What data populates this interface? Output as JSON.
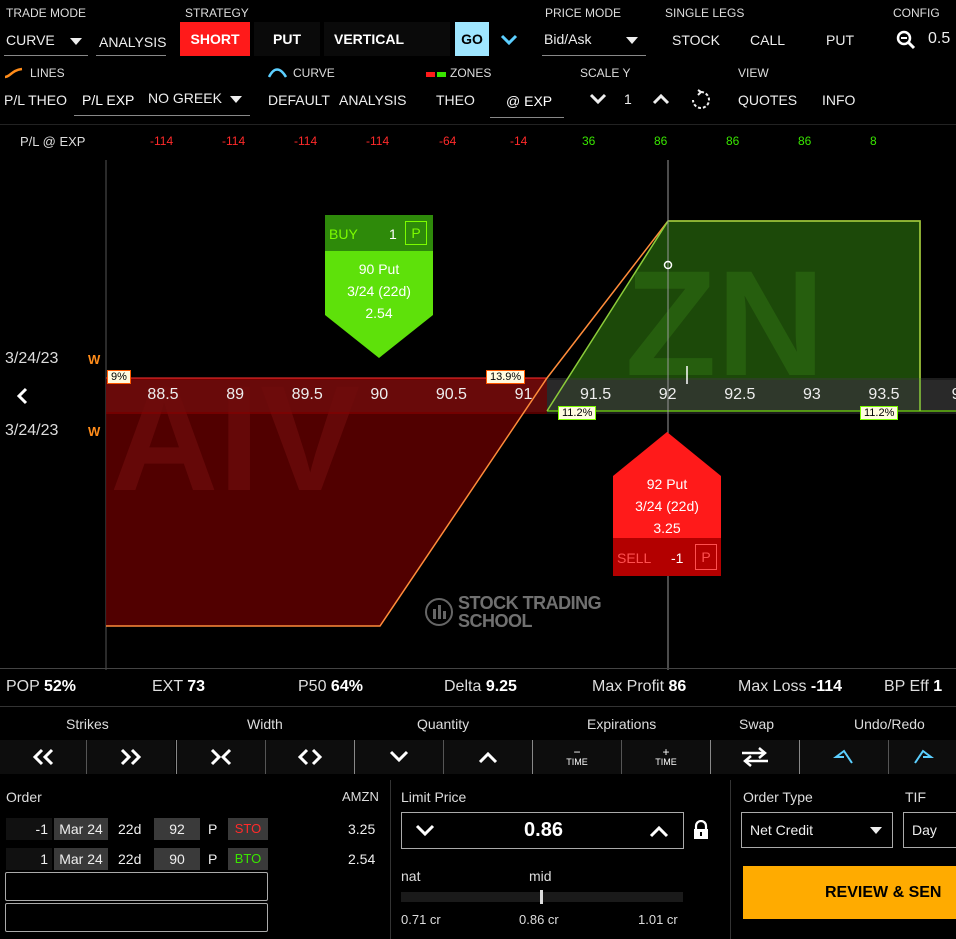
{
  "toolbar_row1": {
    "trade_mode_label": "TRADE MODE",
    "trade_mode_value": "CURVE",
    "analysis_label": "ANALYSIS",
    "strategy_label": "STRATEGY",
    "short_label": "SHORT",
    "put_label": "PUT",
    "vertical_label": "VERTICAL",
    "go_label": "GO",
    "price_mode_label": "PRICE MODE",
    "price_mode_value": "Bid/Ask",
    "single_legs_label": "SINGLE LEGS",
    "stock_label": "STOCK",
    "call_label": "CALL",
    "put_leg_label": "PUT",
    "config_label": "CONFIG",
    "zoom_value": "0.5"
  },
  "toolbar_row2": {
    "lines_label": "LINES",
    "pl_theo_label": "P/L THEO",
    "pl_exp_label": "P/L EXP",
    "greek_value": "NO GREEK",
    "curve_label": "CURVE",
    "default_label": "DEFAULT",
    "analysis_label": "ANALYSIS",
    "zones_label": "ZONES",
    "theo_label": "THEO",
    "at_exp_label": "@ EXP",
    "scale_y_label": "SCALE Y",
    "scale_y_value": "1",
    "view_label": "VIEW",
    "quotes_label": "QUOTES",
    "info_label": "INFO"
  },
  "pl_row": {
    "label": "P/L @ EXP",
    "values": [
      "-114",
      "-114",
      "-114",
      "-114",
      "-64",
      "-14",
      "36",
      "86",
      "86",
      "86",
      "8"
    ]
  },
  "chart": {
    "expiry_top": "3/24/23",
    "expiry_bottom": "3/24/23",
    "weekly_marker": "W",
    "strikes": [
      "88.5",
      "89",
      "89.5",
      "90",
      "90.5",
      "91",
      "91.5",
      "92",
      "92.5",
      "93",
      "93.5",
      "9"
    ],
    "iv_tags": {
      "left_partial": "9%",
      "red_tag": "13.9%",
      "green_left": "11.2%",
      "green_right": "11.2%"
    },
    "watermark": "STOCK TRADING SCHOOL",
    "buy_leg": {
      "action": "BUY",
      "qty": "1",
      "type": "P",
      "desc": "90 Put",
      "date": "3/24 (22d)",
      "price": "2.54",
      "color": "#5ee10a"
    },
    "sell_leg": {
      "action": "SELL",
      "qty": "-1",
      "type": "P",
      "desc": "92 Put",
      "date": "3/24 (22d)",
      "price": "3.25",
      "color": "#ff1a1a"
    },
    "colors": {
      "loss": "#8b0000",
      "profit": "#1f5f0a"
    }
  },
  "chart_data": {
    "type": "line",
    "title": "P/L @ EXP",
    "xlabel": "Strike",
    "ylabel": "P/L",
    "x": [
      88.5,
      89,
      89.5,
      90,
      90.5,
      91,
      91.5,
      92,
      92.5,
      93,
      93.5
    ],
    "series": [
      {
        "name": "P/L @ EXP",
        "values": [
          -114,
          -114,
          -114,
          -114,
          -64,
          -14,
          36,
          86,
          86,
          86,
          86
        ]
      }
    ],
    "ylim": [
      -114,
      86
    ],
    "grid": false
  },
  "stats": {
    "pop_label": "POP",
    "pop_value": "52%",
    "ext_label": "EXT",
    "ext_value": "73",
    "p50_label": "P50",
    "p50_value": "64%",
    "delta_label": "Delta",
    "delta_value": "9.25",
    "max_profit_label": "Max Profit",
    "max_profit_value": "86",
    "max_loss_label": "Max Loss",
    "max_loss_value": "-114",
    "bp_eff_label": "BP Eff",
    "bp_eff_value": "1"
  },
  "controls": {
    "strikes_label": "Strikes",
    "width_label": "Width",
    "quantity_label": "Quantity",
    "expirations_label": "Expirations",
    "swap_label": "Swap",
    "undo_redo_label": "Undo/Redo",
    "time_label": "TIME"
  },
  "order": {
    "order_label": "Order",
    "symbol": "AMZN",
    "legs": [
      {
        "qty": "-1",
        "exp": "Mar 24",
        "days": "22d",
        "strike": "92",
        "type": "P",
        "action": "STO",
        "price": "3.25"
      },
      {
        "qty": "1",
        "exp": "Mar 24",
        "days": "22d",
        "strike": "90",
        "type": "P",
        "action": "BTO",
        "price": "2.54"
      }
    ],
    "limit_price_label": "Limit Price",
    "limit_price_value": "0.86",
    "nat_label": "nat",
    "mid_label": "mid",
    "nat_value": "0.71 cr",
    "mid_value": "0.86 cr",
    "far_value": "1.01 cr",
    "order_type_label": "Order Type",
    "order_type_value": "Net Credit",
    "tif_label": "TIF",
    "tif_value": "Day",
    "review_label": "REVIEW & SEN"
  }
}
